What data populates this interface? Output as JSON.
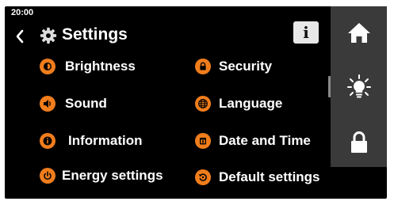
{
  "status": {
    "time": "20:00"
  },
  "header": {
    "title": "Settings",
    "back_icon": "chevron-left-icon",
    "title_icon": "gear-icon",
    "info_label": "i"
  },
  "menu": {
    "left": [
      {
        "label": "Brightness",
        "icon": "brightness-icon"
      },
      {
        "label": "Sound",
        "icon": "speaker-icon"
      },
      {
        "label": "Information",
        "icon": "info-icon"
      },
      {
        "label": "Energy settings",
        "icon": "power-icon"
      }
    ],
    "right": [
      {
        "label": "Security",
        "icon": "lock-icon"
      },
      {
        "label": "Language",
        "icon": "globe-icon"
      },
      {
        "label": "Date and Time",
        "icon": "calendar-icon"
      },
      {
        "label": "Default settings",
        "icon": "reset-icon"
      }
    ]
  },
  "sidebar": {
    "buttons": [
      {
        "icon": "home-icon"
      },
      {
        "icon": "lightbulb-icon"
      },
      {
        "icon": "lock-icon"
      }
    ]
  },
  "colors": {
    "accent": "#f07d1c",
    "background": "#000000",
    "sidebar": "#3a3a3a",
    "text": "#ffffff"
  }
}
